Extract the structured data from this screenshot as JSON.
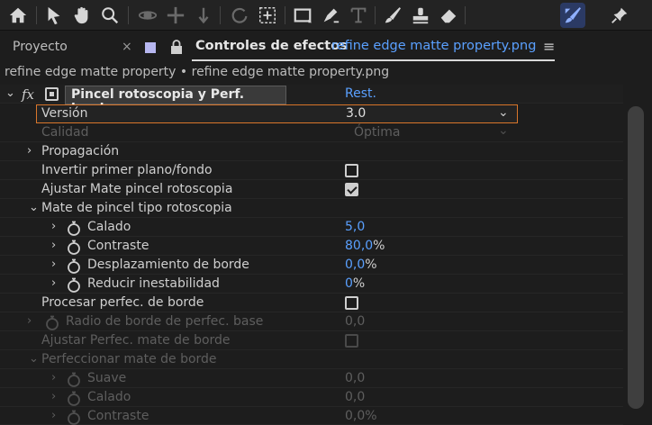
{
  "toolbar": {
    "tools": [
      "home-icon",
      "selection-arrow-icon",
      "hand-icon",
      "zoom-icon",
      "orbit-camera-icon",
      "pan-camera-icon",
      "dolly-camera-icon",
      "rotate-icon",
      "pan-behind-icon",
      "rectangle-icon",
      "pen-icon",
      "type-icon",
      "brush-icon",
      "clone-stamp-icon",
      "eraser-icon",
      "roto-brush-icon",
      "puppet-pin-icon"
    ],
    "active_tool": "roto-brush-icon"
  },
  "tabs": {
    "proyecto": "Proyecto",
    "close": "×",
    "effects_title": "Controles de efectos",
    "effects_file": "refine edge matte property.png",
    "menu": "≡"
  },
  "layer_line": "refine edge matte property • refine edge matte property.png",
  "effect": {
    "fx_label": "fx",
    "name": "Pincel rotoscopia y Perf. borde",
    "reset": "Rest."
  },
  "rows": {
    "version": {
      "label": "Versión",
      "value": "3.0"
    },
    "calidad": {
      "label": "Calidad",
      "value": "Óptima"
    },
    "propagacion": {
      "label": "Propagación"
    },
    "invertir": {
      "label": "Invertir primer plano/fondo",
      "checked": false
    },
    "ajustar_mate": {
      "label": "Ajustar Mate pincel rotoscopia",
      "checked": true
    },
    "mate_group": {
      "label": "Mate de pincel tipo rotoscopia"
    },
    "calado": {
      "label": "Calado",
      "value": "5,0"
    },
    "contraste": {
      "label": "Contraste",
      "value": "80,0",
      "unit": "%"
    },
    "desplazamiento": {
      "label": "Desplazamiento de borde",
      "value": "0,0",
      "unit": "%"
    },
    "reducir": {
      "label": "Reducir inestabilidad",
      "value": "0",
      "unit": "%"
    },
    "procesar": {
      "label": "Procesar perfec. de borde",
      "checked": false
    },
    "radio": {
      "label": "Radio de borde de perfec. base",
      "value": "0,0"
    },
    "ajustar_perfec": {
      "label": "Ajustar Perfec. mate de borde",
      "checked": false
    },
    "perfeccionar_group": {
      "label": "Perfeccionar mate de borde"
    },
    "suave": {
      "label": "Suave",
      "value": "0,0"
    },
    "calado2": {
      "label": "Calado",
      "value": "0,0"
    },
    "contraste2": {
      "label": "Contraste",
      "value": "0,0%"
    }
  }
}
